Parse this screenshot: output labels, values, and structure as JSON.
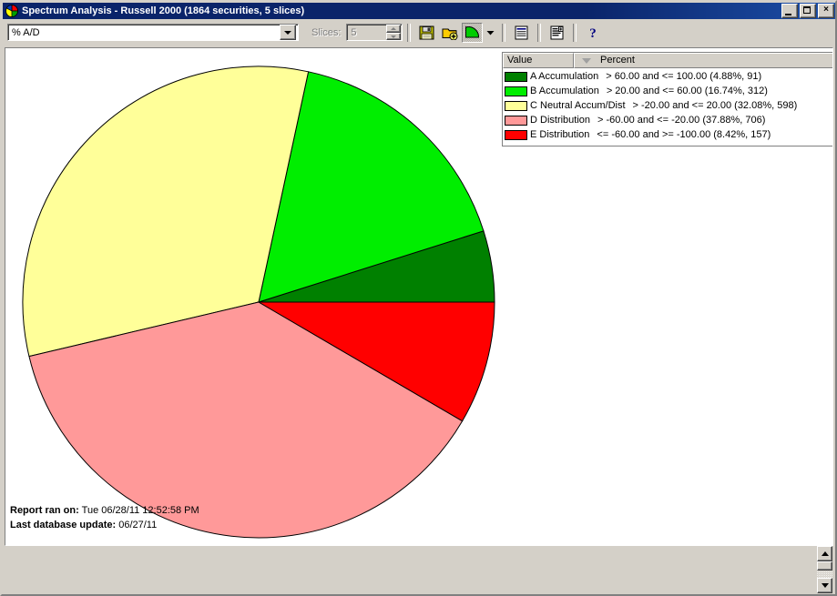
{
  "window": {
    "title": "Spectrum Analysis - Russell 2000 (1864 securities, 5 slices)",
    "icon": "pie-chart-icon",
    "minimize_label": "",
    "maximize_label": "",
    "close_label": "×"
  },
  "toolbar": {
    "field_select_value": "% A/D",
    "slices_label": "Slices:",
    "slices_value": "5",
    "buttons": [
      {
        "name": "save-button",
        "icon": "floppy-disk-icon"
      },
      {
        "name": "open-add-button",
        "icon": "folder-add-icon"
      },
      {
        "name": "chart-type-button",
        "icon": "pie-chart-icon"
      },
      {
        "name": "chart-type-dropdown",
        "icon": "chevron-down-icon"
      },
      {
        "name": "report-view-button",
        "icon": "list-report-icon"
      },
      {
        "name": "detail-report-button",
        "icon": "detail-report-icon"
      },
      {
        "name": "help-button",
        "icon": "question-mark-icon"
      }
    ]
  },
  "legend": {
    "columns": [
      "Value",
      "Percent"
    ],
    "sort_indicator": "descending",
    "rows": [
      {
        "color": "#008000",
        "name": "A Accumulation",
        "range": "> 60.00 and <= 100.00 (4.88%, 91)"
      },
      {
        "color": "#00EE00",
        "name": "B Accumulation",
        "range": "> 20.00 and <= 60.00 (16.74%, 312)"
      },
      {
        "color": "#FFFF99",
        "name": "C Neutral Accum/Dist",
        "range": "> -20.00 and <= 20.00 (32.08%, 598)"
      },
      {
        "color": "#FF9999",
        "name": "D Distribution",
        "range": "> -60.00 and <= -20.00 (37.88%, 706)"
      },
      {
        "color": "#FF0000",
        "name": "E Distribution",
        "range": "<= -60.00 and >= -100.00 (8.42%, 157)"
      }
    ]
  },
  "footer": {
    "report_ran_label": "Report ran on:",
    "report_ran_value": "Tue 06/28/11 12:52:58 PM",
    "last_update_label": "Last database update:",
    "last_update_value": "06/27/11"
  },
  "chart_data": {
    "type": "pie",
    "title": "Spectrum Analysis - Russell 2000",
    "total_securities": 1864,
    "slice_count": 5,
    "start_angle_deg": 0,
    "direction": "counterclockwise",
    "center": [
      262,
      262
    ],
    "radius": 259,
    "categories": [
      "A Accumulation",
      "B Accumulation",
      "C Neutral Accum/Dist",
      "D Distribution",
      "E Distribution"
    ],
    "values": [
      4.88,
      16.74,
      32.08,
      37.88,
      8.42
    ],
    "counts": [
      91,
      312,
      598,
      706,
      157
    ],
    "colors": [
      "#008000",
      "#00EE00",
      "#FFFF99",
      "#FF9999",
      "#FF0000"
    ],
    "ranges": [
      "> 60.00 and <= 100.00",
      "> 20.00 and <= 60.00",
      "> -20.00 and <= 20.00",
      "> -60.00 and <= -20.00",
      "<= -60.00 and >= -100.00"
    ],
    "ylabel": "",
    "xlabel": "",
    "legend_position": "right"
  }
}
